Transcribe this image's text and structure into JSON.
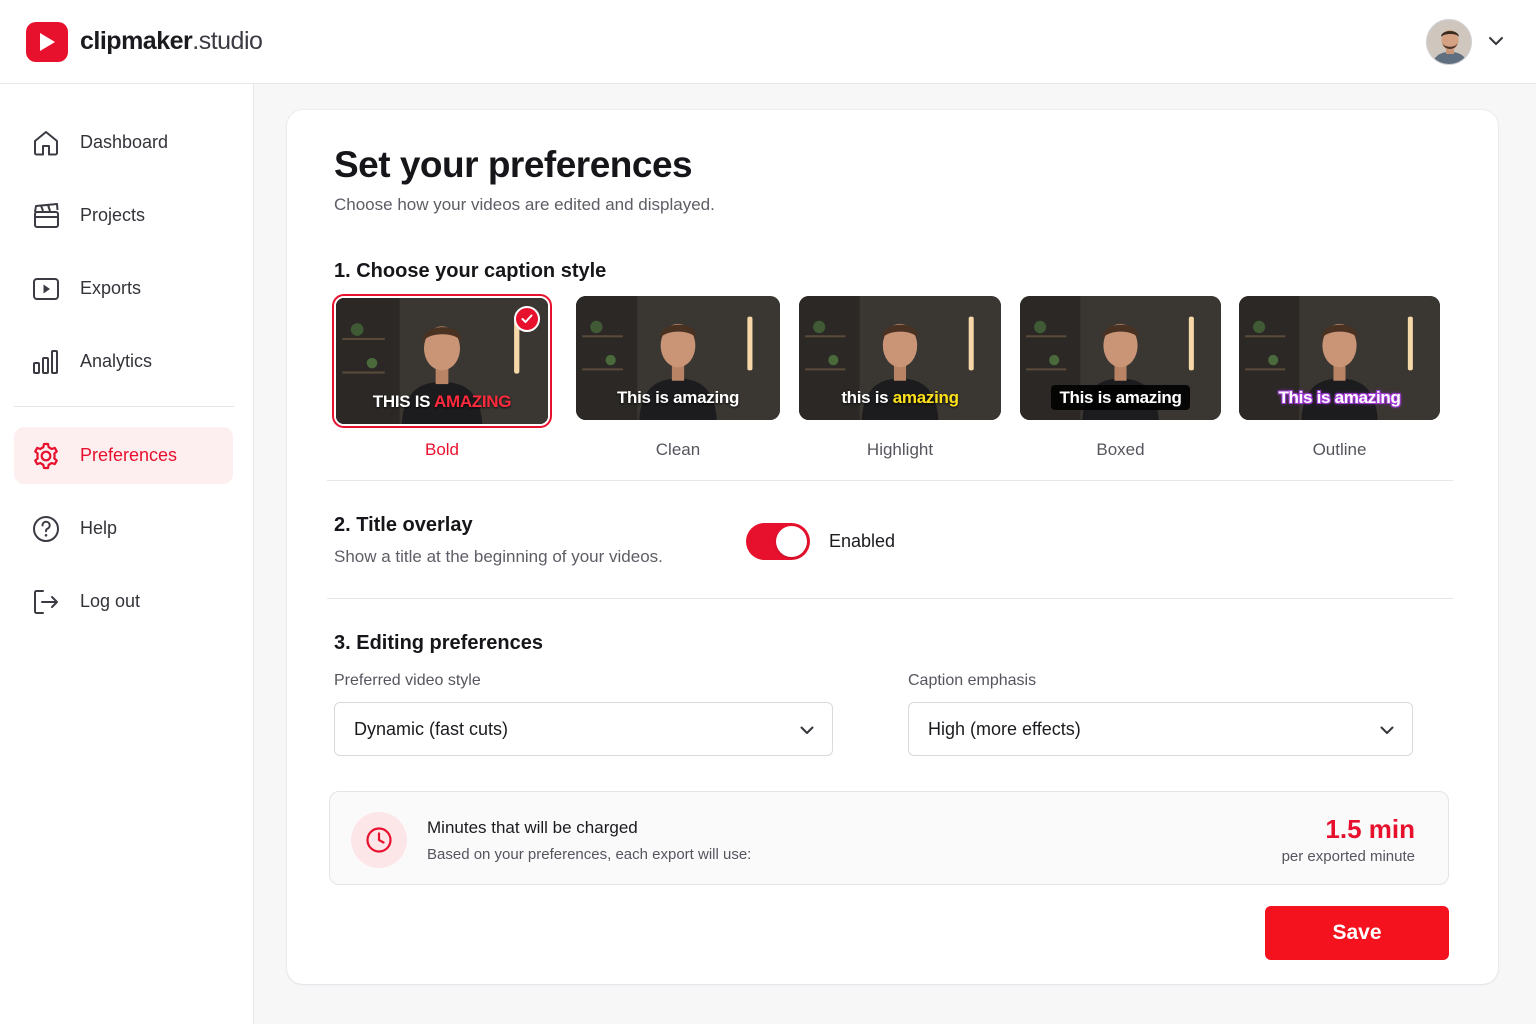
{
  "brand": {
    "name_bold": "clipmaker",
    "name_light": ".studio"
  },
  "user": {
    "avatar_icon": "user-avatar",
    "menu_icon": "chevron-down-icon"
  },
  "sidebar": {
    "items": [
      {
        "label": "Dashboard",
        "icon": "home-icon",
        "active": false
      },
      {
        "label": "Projects",
        "icon": "clapperboard-icon",
        "active": false
      },
      {
        "label": "Exports",
        "icon": "play-square-icon",
        "active": false
      },
      {
        "label": "Analytics",
        "icon": "bar-chart-icon",
        "active": false
      },
      {
        "label": "Preferences",
        "icon": "gear-icon",
        "active": true
      },
      {
        "label": "Help",
        "icon": "help-circle-icon",
        "active": false
      },
      {
        "label": "Log out",
        "icon": "logout-icon",
        "active": false
      }
    ]
  },
  "page": {
    "title": "Set your preferences",
    "subtitle": "Choose how your videos are edited and displayed."
  },
  "caption_section": {
    "title": "1. Choose your caption style",
    "styles": [
      {
        "label": "Bold",
        "caption_main": "THIS IS ",
        "caption_accent": "AMAZING",
        "selected": true
      },
      {
        "label": "Clean",
        "caption_main": "This is amazing",
        "selected": false
      },
      {
        "label": "Highlight",
        "caption_main": "this is ",
        "caption_accent": "amazing",
        "selected": false
      },
      {
        "label": "Boxed",
        "caption_main": "This is amazing",
        "selected": false
      },
      {
        "label": "Outline",
        "caption_main": "This is amazing",
        "selected": false
      }
    ]
  },
  "overlay_section": {
    "title": "2. Title overlay",
    "description": "Show a title at the beginning of your videos.",
    "toggle_on": true,
    "toggle_label": "Enabled"
  },
  "editing_section": {
    "title": "3. Editing preferences",
    "video_style": {
      "label": "Preferred video style",
      "value": "Dynamic (fast cuts)"
    },
    "caption_emphasis": {
      "label": "Caption emphasis",
      "value": "High (more effects)"
    }
  },
  "charge": {
    "title": "Minutes that will be charged",
    "subtitle": "Based on your preferences, each export will use:",
    "value": "1.5 min",
    "unit": "per exported minute",
    "icon": "clock-icon"
  },
  "save_label": "Save",
  "colors": {
    "accent": "#e8112d",
    "accent_soft": "#fdeef0",
    "highlight_yellow": "#ffe11a",
    "outline_purple": "#a23cd6"
  }
}
